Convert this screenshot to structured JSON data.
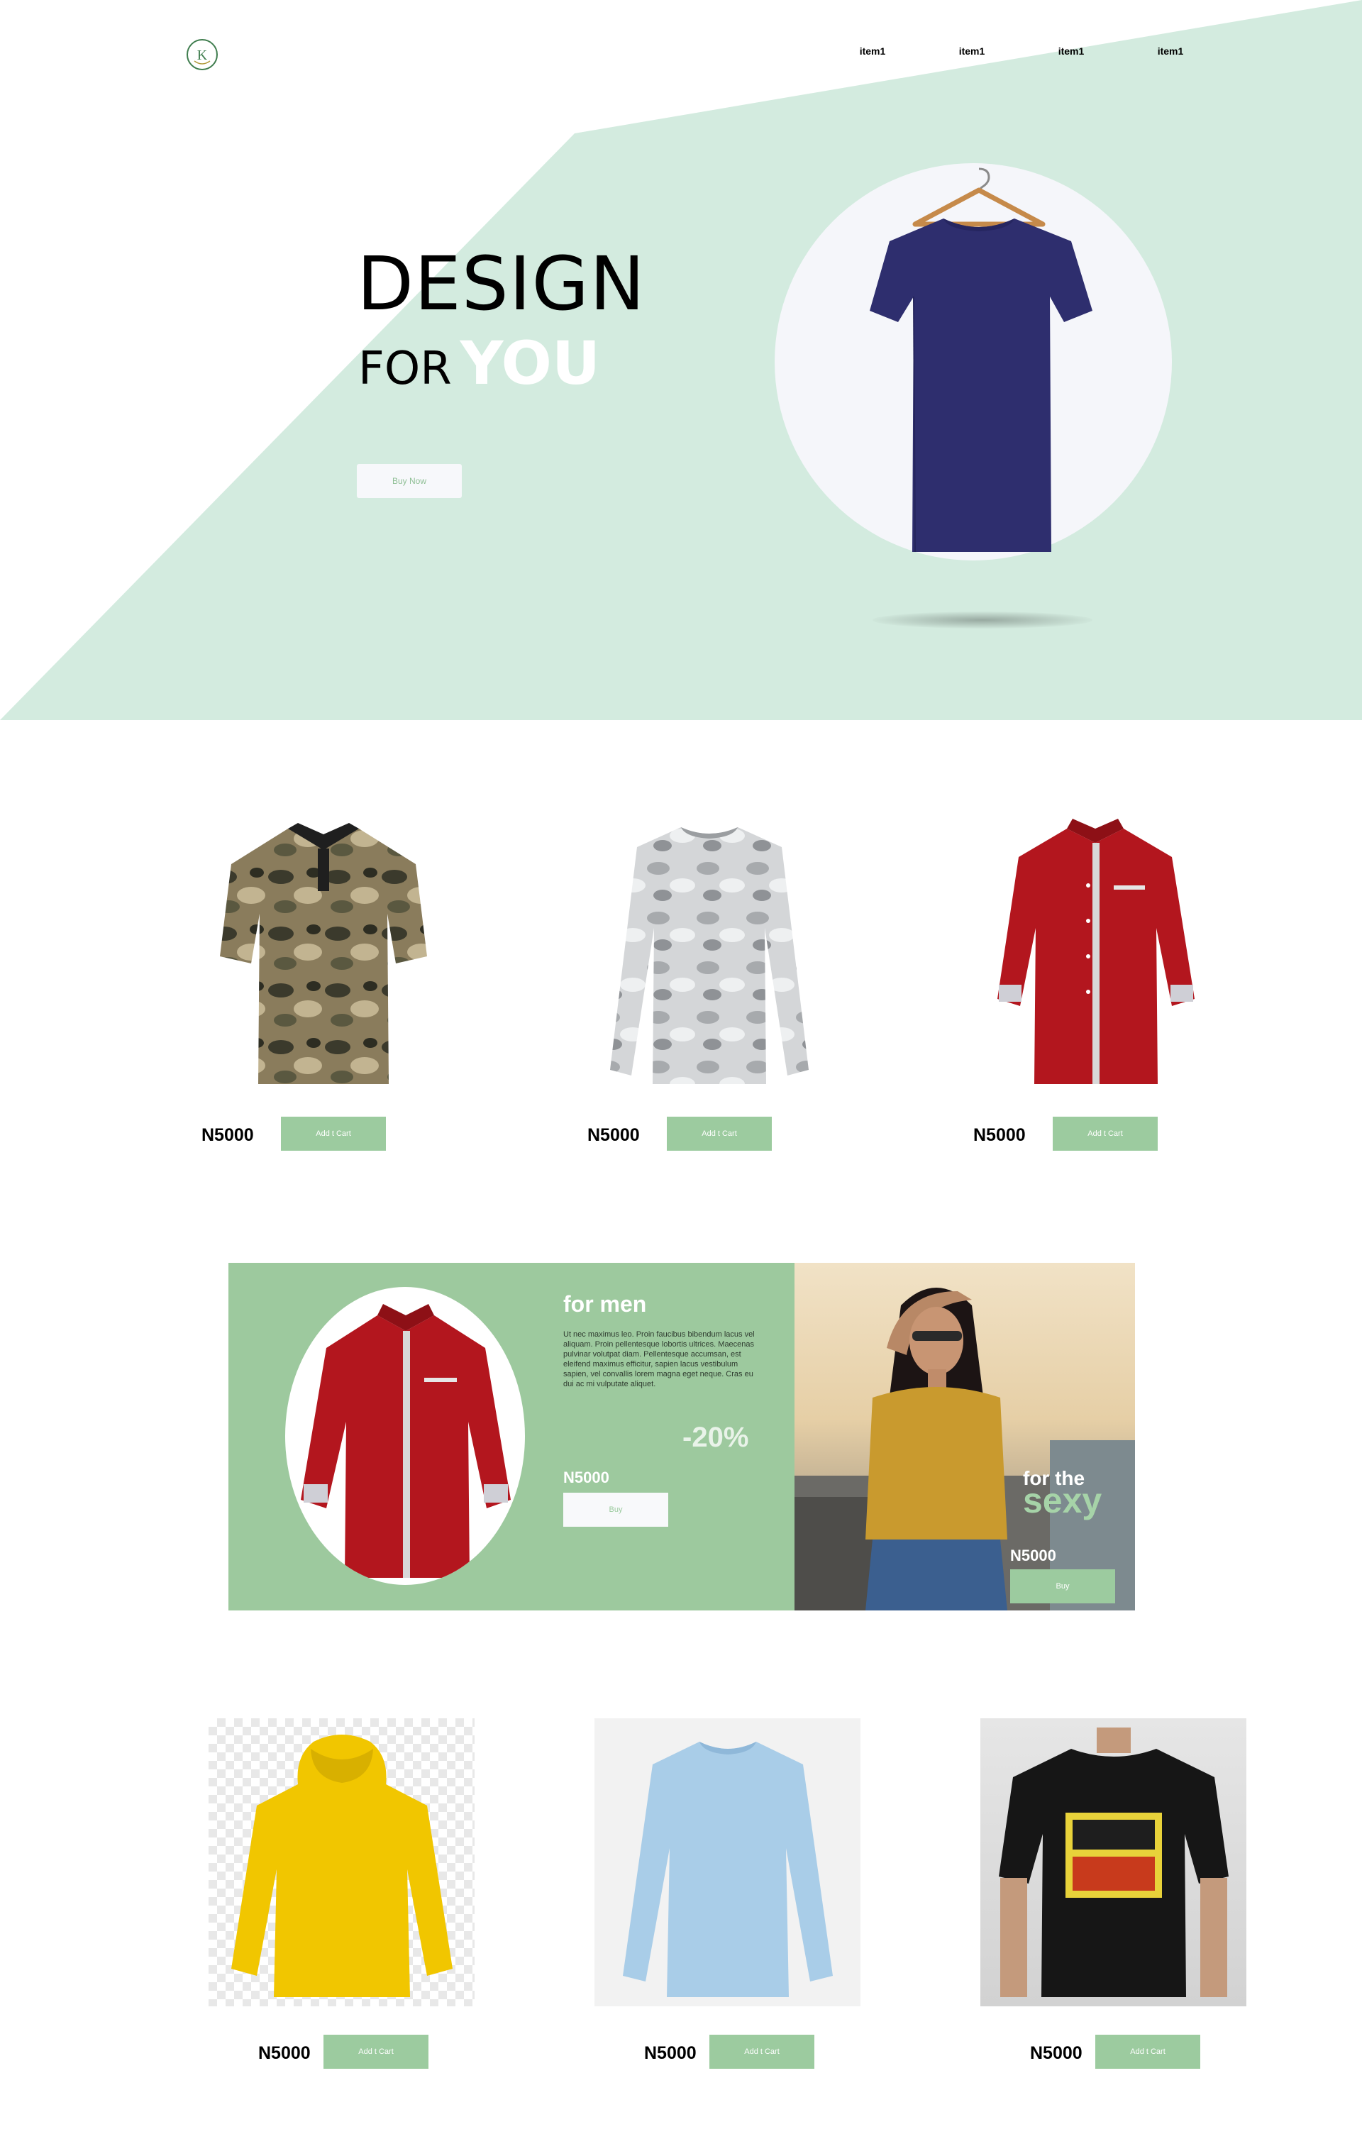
{
  "nav": {
    "items": [
      "item1",
      "item1",
      "item1",
      "item1"
    ]
  },
  "hero": {
    "title": "DESIGN",
    "subtitle_for": "FOR",
    "subtitle_you": "YOU",
    "button": "Buy Now"
  },
  "products_row1": [
    {
      "price": "N5000",
      "button": "Add t Cart",
      "image": "camo-polo-shirt"
    },
    {
      "price": "N5000",
      "button": "Add t Cart",
      "image": "camo-long-sleeve"
    },
    {
      "price": "N5000",
      "button": "Add t Cart",
      "image": "red-dress-shirt"
    }
  ],
  "promo": {
    "title": "for men",
    "text": "Ut nec maximus leo. Proin faucibus bibendum lacus vel aliquam. Proin pellentesque lobortis ultrices. Maecenas pulvinar volutpat diam. Pellentesque accumsan, est eleifend maximus efficitur, sapien lacus vestibulum sapien, vel convallis lorem magna eget neque. Cras eu dui ac mi vulputate aliquet.",
    "discount": "-20%",
    "price": "N5000",
    "button": "Buy",
    "side_line1": "for the",
    "side_line2": "sexy",
    "side_price": "N5000",
    "side_button": "Buy"
  },
  "products_row2": [
    {
      "price": "N5000",
      "button": "Add t Cart",
      "image": "yellow-hoodie"
    },
    {
      "price": "N5000",
      "button": "Add t Cart",
      "image": "light-blue-long-sleeve"
    },
    {
      "price": "N5000",
      "button": "Add t Cart",
      "image": "black-full-hd-tshirt"
    }
  ],
  "colors": {
    "mint": "#d3ebdf",
    "accent_green": "#9dc99e",
    "light_button": "#f7f8fb"
  }
}
